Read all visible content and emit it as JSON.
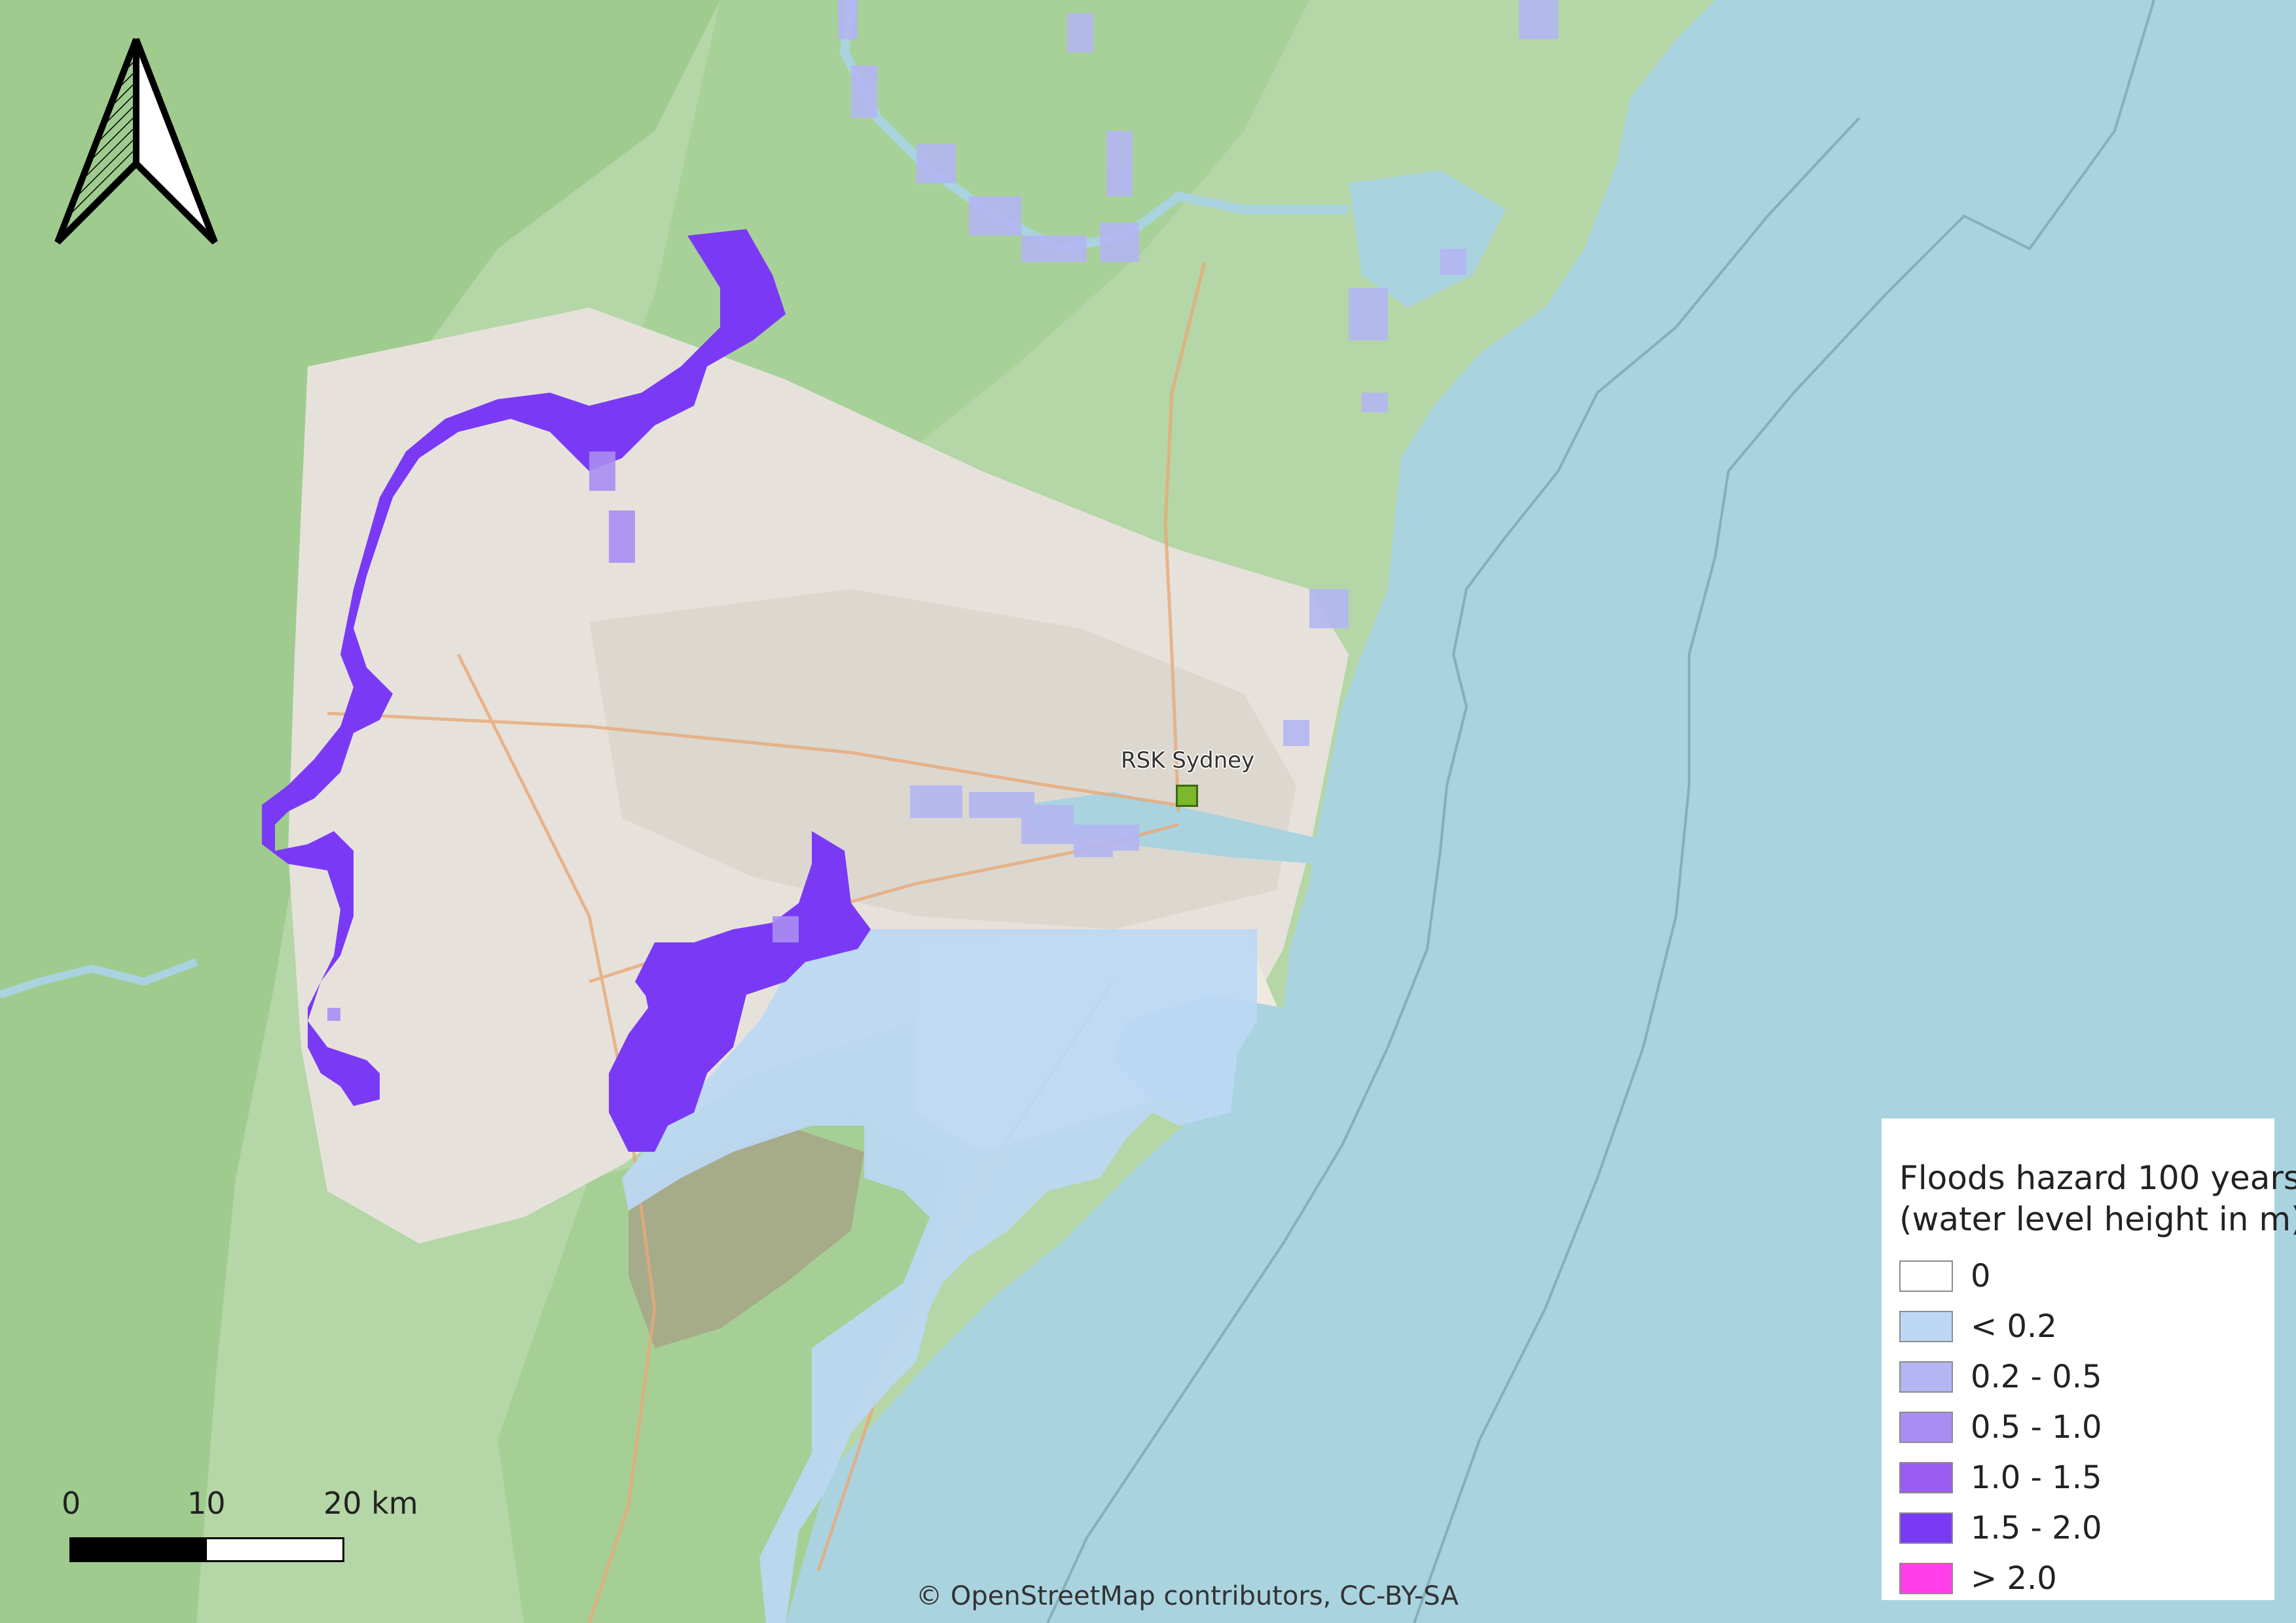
{
  "map": {
    "title_hidden": "",
    "place": {
      "name": "RSK Sydney",
      "marker_color": "#7cb82a"
    },
    "attribution": "© OpenStreetMap contributors, CC-BY-SA"
  },
  "legend": {
    "title_line1": "Floods hazard 100 years",
    "title_line2": "(water level height in m)",
    "items": [
      {
        "label": "0",
        "color": "#ffffff"
      },
      {
        "label": "< 0.2",
        "color": "#bcd8f5"
      },
      {
        "label": "0.2 - 0.5",
        "color": "#b3b6f2"
      },
      {
        "label": "0.5 - 1.0",
        "color": "#a88ef2"
      },
      {
        "label": "1.0 - 1.5",
        "color": "#9b5cf0"
      },
      {
        "label": "1.5 - 2.0",
        "color": "#7a3af5"
      },
      {
        "label": "> 2.0",
        "color": "#ff3fea"
      }
    ]
  },
  "scalebar": {
    "labels": [
      "0",
      "10",
      "20 km"
    ]
  },
  "icons": {
    "north": "north-arrow-icon"
  },
  "colors": {
    "water": "#a9d3df",
    "forest": "#a5cf97",
    "urban": "#e4e1da",
    "land": "#f2efe9"
  }
}
